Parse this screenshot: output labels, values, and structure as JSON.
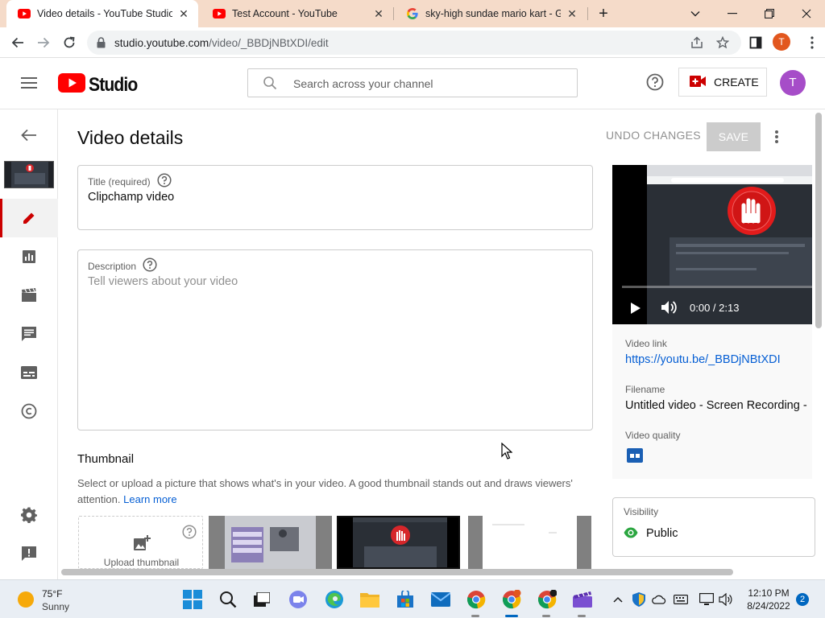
{
  "browser": {
    "tabs": [
      {
        "label": "Video details - YouTube Studio",
        "active": true,
        "favicon": "youtube-icon"
      },
      {
        "label": "Test Account - YouTube",
        "active": false,
        "favicon": "youtube-icon"
      },
      {
        "label": "sky-high sundae mario kart - Go",
        "active": false,
        "favicon": "google-icon"
      }
    ],
    "url_host": "studio.youtube.com",
    "url_path": "/video/_BBDjNBtXDI/edit",
    "profile_initial": "T"
  },
  "header": {
    "logo_text": "Studio",
    "search_placeholder": "Search across your channel",
    "create_label": "CREATE",
    "avatar_initial": "T"
  },
  "page": {
    "title": "Video details",
    "undo_label": "UNDO CHANGES",
    "save_label": "SAVE"
  },
  "form": {
    "title_label": "Title (required)",
    "title_value": "Clipchamp video",
    "description_label": "Description",
    "description_placeholder": "Tell viewers about your video"
  },
  "thumbnail": {
    "heading": "Thumbnail",
    "description": "Select or upload a picture that shows what's in your video. A good thumbnail stands out and draws viewers' attention.",
    "learn_more": "Learn more",
    "upload_label": "Upload thumbnail"
  },
  "preview": {
    "time": "0:00 / 2:13",
    "progress_fraction": 0.0
  },
  "info": {
    "video_link_label": "Video link",
    "video_link": "https://youtu.be/_BBDjNBtXDI",
    "filename_label": "Filename",
    "filename": "Untitled video - Screen Recording - ",
    "quality_label": "Video quality"
  },
  "visibility": {
    "label": "Visibility",
    "value": "Public"
  },
  "taskbar": {
    "temperature": "75°F",
    "condition": "Sunny",
    "time": "12:10 PM",
    "date": "8/24/2022",
    "notifications": "2"
  },
  "colors": {
    "youtube_red": "#ff0000",
    "studio_red": "#cc0000",
    "link_blue": "#065fd4",
    "avatar_purple": "#a64dc8",
    "tab_strip": "#f5dbc9",
    "visibility_green": "#2ba640"
  }
}
